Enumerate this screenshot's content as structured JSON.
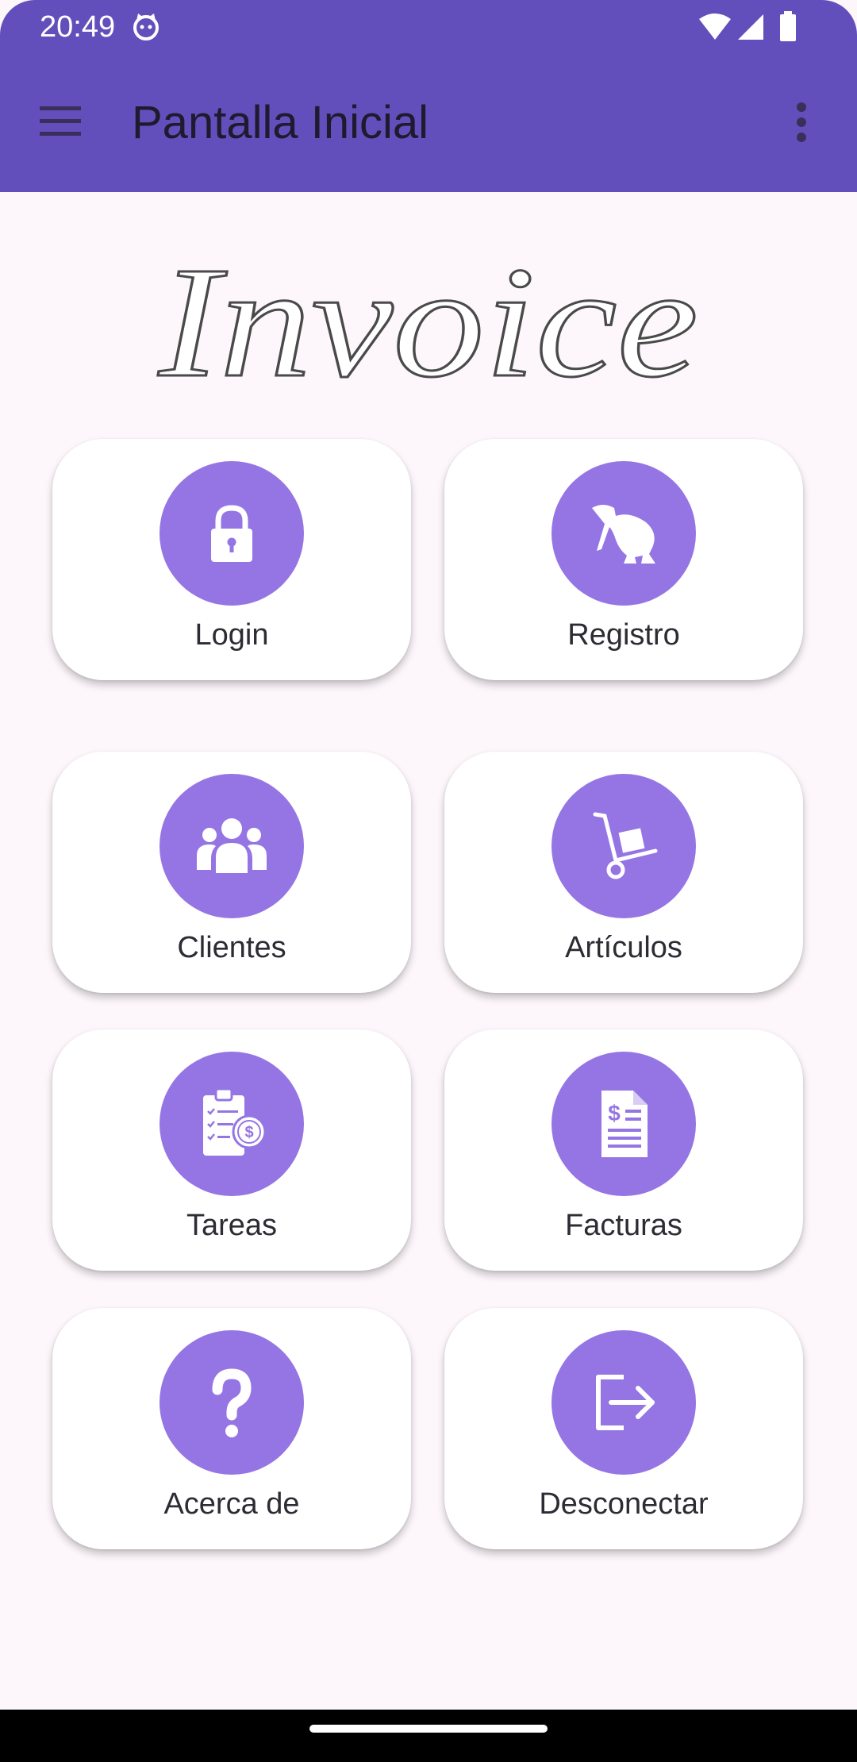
{
  "status_bar": {
    "time": "20:49",
    "icons": [
      "cat-notification-icon",
      "wifi-icon",
      "signal-icon",
      "battery-icon"
    ]
  },
  "app_bar": {
    "title": "Pantalla Inicial",
    "menu_icon": "hamburger-menu-icon",
    "overflow_icon": "more-vert-icon"
  },
  "logo": {
    "text": "Invoice"
  },
  "tiles": [
    {
      "label": "Login",
      "icon": "lock-icon"
    },
    {
      "label": "Registro",
      "icon": "kiwi-bird-icon"
    },
    {
      "label": "Clientes",
      "icon": "users-icon"
    },
    {
      "label": "Artículos",
      "icon": "hand-truck-icon"
    },
    {
      "label": "Tareas",
      "icon": "clipboard-dollar-icon"
    },
    {
      "label": "Facturas",
      "icon": "invoice-icon"
    },
    {
      "label": "Acerca de",
      "icon": "question-icon"
    },
    {
      "label": "Desconectar",
      "icon": "logout-icon"
    }
  ],
  "colors": {
    "app_bar": "#634fbb",
    "tile_circle": "#9575e4",
    "background": "#fdf7fb"
  }
}
